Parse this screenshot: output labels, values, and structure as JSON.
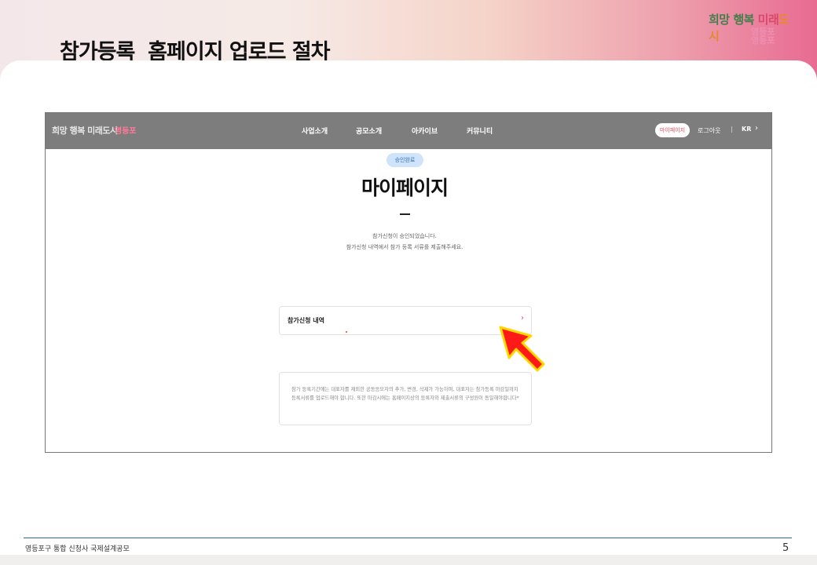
{
  "slide": {
    "title": "참가등록  홈페이지 업로드 절차",
    "logo": {
      "part1": "희망 행복 ",
      "part2": "미래",
      "part3": "도시",
      "sub_line1": "영등포",
      "sub_line2": "영등포"
    },
    "footer_text": "영등포구 통합 신청사 국제설계공모",
    "page_number": "5"
  },
  "website": {
    "nav": {
      "logo_main": "희망 행복 미래도시",
      "logo_sub": "영등포",
      "menu": [
        "사업소개",
        "공모소개",
        "아카이브",
        "커뮤니티"
      ],
      "mypage_label": "마이페이지",
      "logout_label": "로그아웃",
      "separator": "|",
      "lang_label": "KR",
      "lang_chevron": "›"
    },
    "status_badge": "승인완료",
    "page_title": "마이페이지",
    "notice_line1": "참가신청이 승인되었습니다.",
    "notice_line2": "참가신청 내역에서 참가 등록 서류를 제출해주세요.",
    "history_label": "참가신청 내역",
    "history_chevron": "›",
    "info_text": "참가 등록기간에는 대표자를 제외한 공동응모자의 추가, 변경, 삭제가 가능하며, 대표자는 참가등록 마감일까지 등록서류를 업로드해야 합니다. 또한 마감시에는 홈페이지상의 등록자와 제출서류의 구성원이 동일해야합니다*"
  },
  "colors": {
    "accent_red": "#e04a5f",
    "nav_gray": "#7d7d7d",
    "badge_blue": "#cfe3fb",
    "pointer_fill": "#ff1a1a",
    "pointer_outline": "#ffd800"
  },
  "icons": {
    "pointer": "cursor-arrow-icon"
  }
}
